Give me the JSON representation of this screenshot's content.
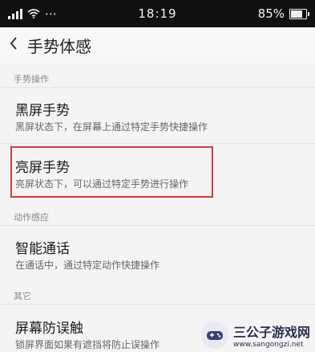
{
  "status_bar": {
    "time": "18:19",
    "battery": "85%",
    "battery_level": 0.85,
    "signal_bars": 4,
    "extra": "⋯"
  },
  "header": {
    "back_icon": "chevron-left-icon",
    "title": "手势体感"
  },
  "sections": [
    {
      "label": "手势操作"
    },
    {
      "label": "动作感应"
    },
    {
      "label": "其它"
    }
  ],
  "items": [
    {
      "title": "黑屏手势",
      "desc": "黑屏状态下，在屏幕上通过特定手势快捷操作"
    },
    {
      "title": "亮屏手势",
      "desc": "亮屏状态下，可以通过特定手势进行操作"
    },
    {
      "title": "智能通话",
      "desc": "在通话中，通过特定动作快捷操作"
    },
    {
      "title": "屏幕防误触",
      "desc": "锁屏界面如果有遮挡将防止误操作"
    }
  ],
  "watermark": {
    "name": "三公子游戏网",
    "url": "www.sangongzi.net"
  },
  "colors": {
    "highlight": "#d23b3b",
    "statusbar": "#111111"
  }
}
